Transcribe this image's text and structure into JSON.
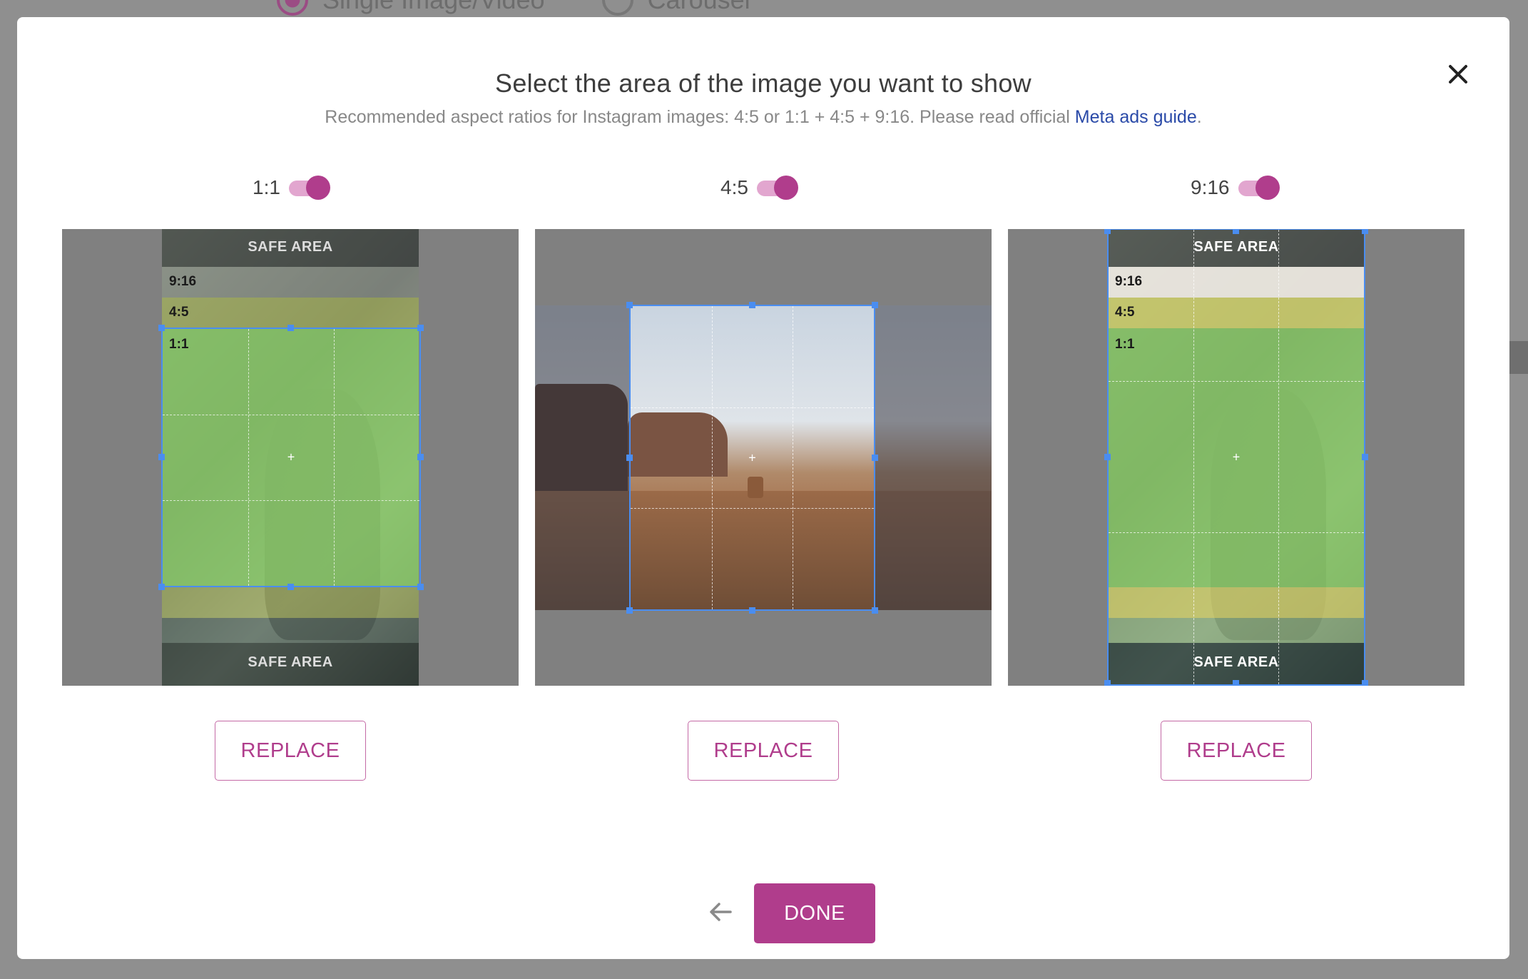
{
  "background": {
    "radio_single_label": "Single Image/Video",
    "radio_carousel_label": "Carousel"
  },
  "modal": {
    "title": "Select the area of the image you want to show",
    "subtitle_text": "Recommended aspect ratios for Instagram images: 4:5 or 1:1 + 4:5 + 9:16. Please read official ",
    "subtitle_link": "Meta ads guide",
    "subtitle_end": ".",
    "close_icon": "close-icon"
  },
  "toggles": [
    {
      "label": "1:1",
      "on": true
    },
    {
      "label": "4:5",
      "on": true
    },
    {
      "label": "9:16",
      "on": true
    }
  ],
  "panels": {
    "p1": {
      "safe_top": "SAFE AREA",
      "safe_bottom": "SAFE AREA",
      "band_916": "9:16",
      "band_45": "4:5",
      "band_11": "1:1"
    },
    "p3": {
      "safe_top": "SAFE AREA",
      "safe_bottom": "SAFE AREA",
      "band_916": "9:16",
      "band_45": "4:5",
      "band_11": "1:1"
    }
  },
  "buttons": {
    "replace": "REPLACE",
    "done": "DONE"
  },
  "colors": {
    "accent": "#b03d8c",
    "crop_border": "#4a8df0",
    "link": "#2a4aa8",
    "band_11": "#8fd36a",
    "band_45": "#d4d36e",
    "band_916": "#ece8e0"
  }
}
